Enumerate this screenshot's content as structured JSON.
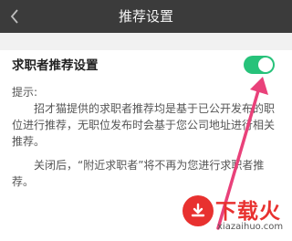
{
  "header": {
    "title": "推荐设置",
    "back_icon": "chevron-left-icon"
  },
  "setting": {
    "label": "求职者推荐设置",
    "toggle_on": true,
    "toggle_color": "#27c27a"
  },
  "tips": {
    "label": "提示:",
    "paragraph1": "招才猫提供的求职者推荐均是基于已公开发布的职位进行推荐，无职位发布时会基于您公司地址进行相关推荐。",
    "paragraph2": "关闭后，“附近求职者”将不再为您进行求职者推荐。"
  },
  "annotation": {
    "arrow_color": "#e9417a"
  },
  "watermark": {
    "brand": "下载火",
    "url": "xiazaihuo.com",
    "color": "#e8312f"
  }
}
